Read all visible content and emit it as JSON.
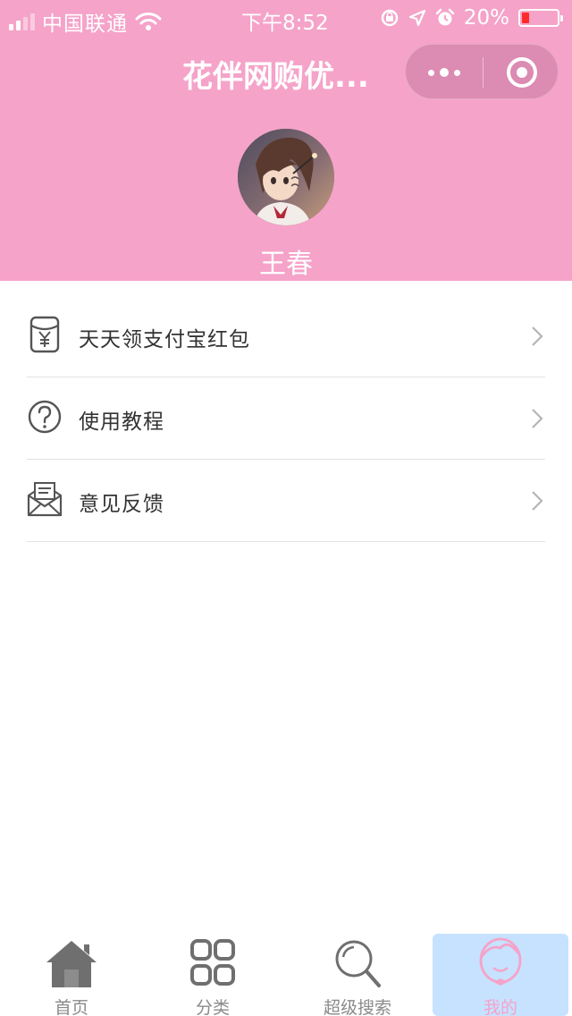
{
  "status_bar": {
    "carrier": "中国联通",
    "time": "下午8:52",
    "battery": "20%",
    "battery_level": 0.2
  },
  "header": {
    "title": "花伴网购优...",
    "background": "#f5a3c9"
  },
  "profile": {
    "name": "王春"
  },
  "menu": {
    "items": [
      {
        "label": "天天领支付宝红包",
        "icon": "red-packet-icon"
      },
      {
        "label": "使用教程",
        "icon": "question-icon"
      },
      {
        "label": "意见反馈",
        "icon": "mail-icon"
      }
    ]
  },
  "tabbar": {
    "active_color": "#f5a3c9",
    "active_bg": "#c6e2ff",
    "tabs": [
      {
        "label": "首页",
        "icon": "home-icon"
      },
      {
        "label": "分类",
        "icon": "grid-icon"
      },
      {
        "label": "超级搜索",
        "icon": "search-icon"
      },
      {
        "label": "我的",
        "icon": "user-icon",
        "active": true
      }
    ]
  }
}
